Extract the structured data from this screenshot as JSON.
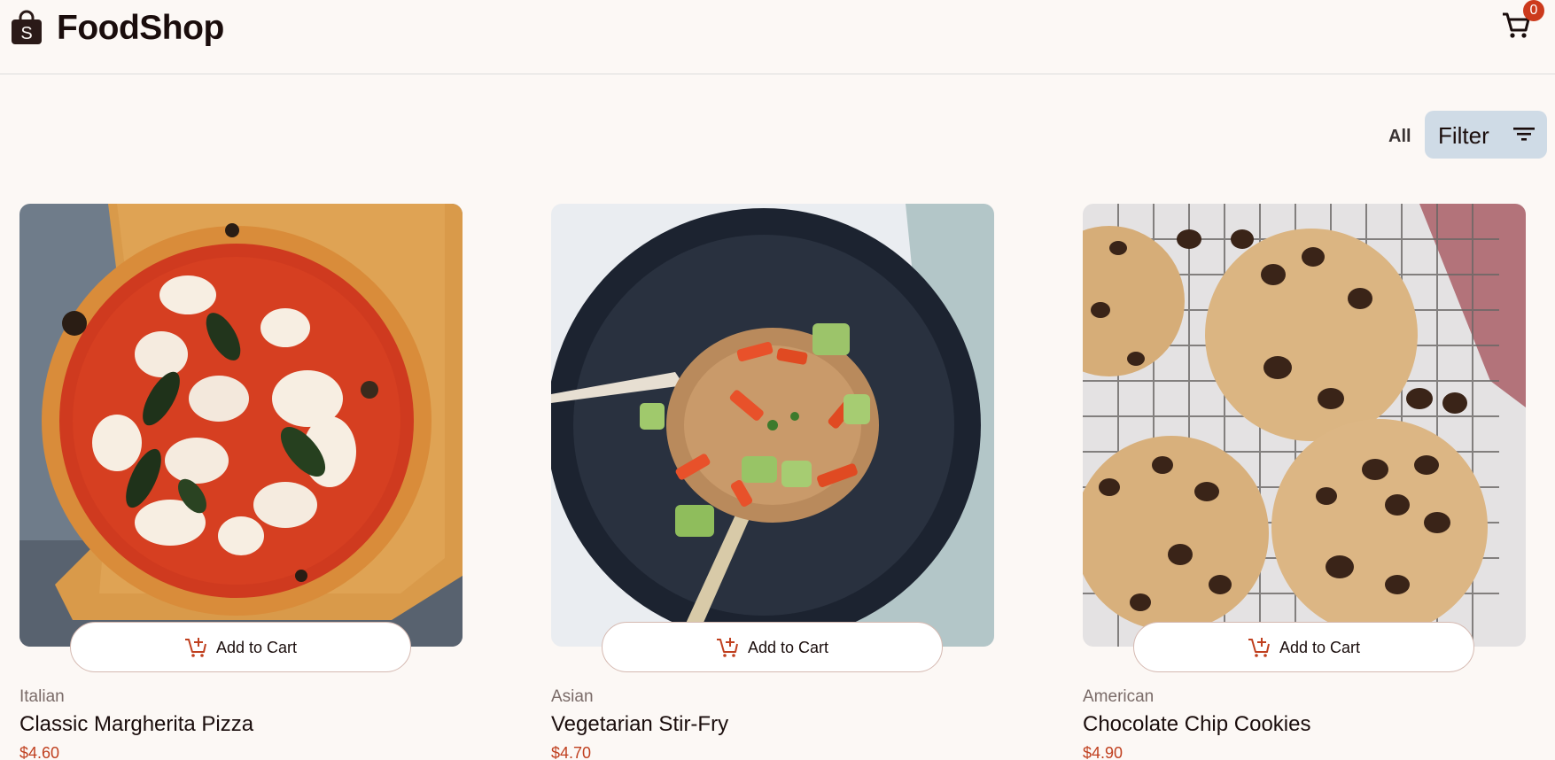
{
  "header": {
    "brand": "FoodShop",
    "logo_icon": "shopping-bag-icon",
    "cart_icon": "shopping-cart-icon",
    "cart_count": "0"
  },
  "filters": {
    "all_label": "All",
    "filter_label": "Filter",
    "filter_icon": "filter-lines-icon"
  },
  "colors": {
    "background": "#fcf8f5",
    "accent": "#cc3a1c",
    "filter_button": "#cfdbe6",
    "price": "#c0401f"
  },
  "products": [
    {
      "category": "Italian",
      "name": "Classic Margherita Pizza",
      "price": "$4.60",
      "add_label": "Add to Cart",
      "image": "pizza"
    },
    {
      "category": "Asian",
      "name": "Vegetarian Stir-Fry",
      "price": "$4.70",
      "add_label": "Add to Cart",
      "image": "stir-fry"
    },
    {
      "category": "American",
      "name": "Chocolate Chip Cookies",
      "price": "$4.90",
      "add_label": "Add to Cart",
      "image": "cookies"
    }
  ]
}
